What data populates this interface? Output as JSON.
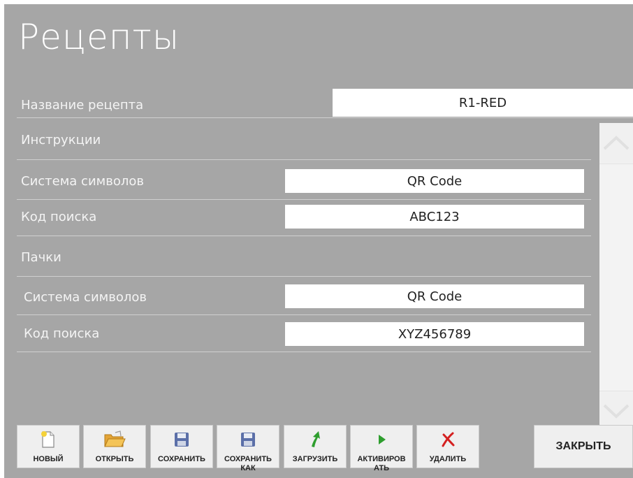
{
  "header": {
    "title": "Рецепты"
  },
  "recipe": {
    "name_label": "Название рецепта",
    "name_value": "R1-RED"
  },
  "instructions": {
    "section_label": "Инструкции",
    "symbology_label": "Система символов",
    "symbology_value": "QR Code",
    "search_code_label": "Код поиска",
    "search_code_value": "ABC123"
  },
  "packs": {
    "section_label": "Пачки",
    "symbology_label": "Система символов",
    "symbology_value": "QR Code",
    "search_code_label": "Код поиска",
    "search_code_value": "XYZ456789"
  },
  "toolbar": {
    "new_label": "НОВЫЙ",
    "open_label": "ОТКРЫТЬ",
    "save_label": "СОХРАНИТЬ",
    "save_as_label": "СОХРАНИТЬ КАК",
    "load_label": "ЗАГРУЗИТЬ",
    "activate_label": "АКТИВИРОВ АТЬ",
    "delete_label": "УДАЛИТЬ",
    "close_label": "ЗАКРЫТЬ"
  },
  "icons": {
    "new": "new-document-icon",
    "open": "open-folder-icon",
    "save": "floppy-disk-icon",
    "save_as": "floppy-disk-icon",
    "load": "green-arrow-up-icon",
    "activate": "play-icon",
    "delete": "red-x-icon",
    "scroll_up": "chevron-up-icon",
    "scroll_down": "chevron-down-icon"
  },
  "colors": {
    "background": "#a6a6a6",
    "field": "#ffffff",
    "button": "#efefef",
    "load_icon": "#2e9e2e",
    "activate_icon": "#2e9e2e",
    "delete_icon": "#d42020"
  }
}
